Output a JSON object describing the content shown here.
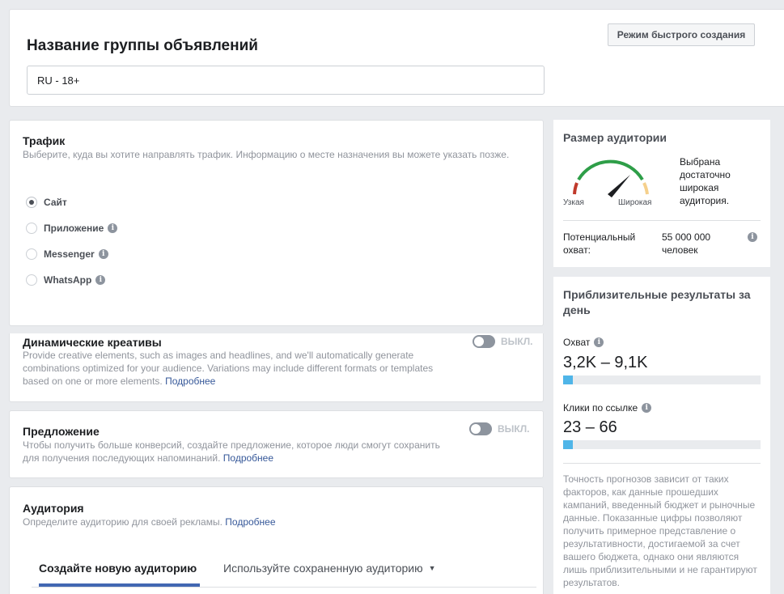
{
  "top": {
    "title": "Название группы объявлений",
    "quick_mode_button": "Режим быстрого создания",
    "ad_set_name": "RU - 18+"
  },
  "traffic": {
    "title": "Трафик",
    "description": "Выберите, куда вы хотите направлять трафик. Информацию о месте назначения вы можете указать позже.",
    "options": [
      {
        "label": "Сайт",
        "checked": true,
        "info": false
      },
      {
        "label": "Приложение",
        "checked": false,
        "info": true
      },
      {
        "label": "Messenger",
        "checked": false,
        "info": true
      },
      {
        "label": "WhatsApp",
        "checked": false,
        "info": true
      }
    ]
  },
  "dynamic": {
    "title": "Динамические креативы",
    "description": "Provide creative elements, such as images and headlines, and we'll automatically generate combinations optimized for your audience. Variations may include different formats or templates based on one or more elements.",
    "link": "Подробнее",
    "toggle_label": "ВЫКЛ."
  },
  "offer": {
    "title": "Предложение",
    "description": "Чтобы получить больше конверсий, создайте предложение, которое люди смогут сохранить для получения последующих напоминаний.",
    "link": "Подробнее",
    "toggle_label": "ВЫКЛ."
  },
  "audience": {
    "title": "Аудитория",
    "description": "Определите аудиторию для своей рекламы.",
    "link": "Подробнее",
    "tab_new": "Создайте новую аудиторию",
    "tab_saved": "Используйте сохраненную аудиторию"
  },
  "audience_size": {
    "title": "Размер аудитории",
    "narrow_label": "Узкая",
    "wide_label": "Широкая",
    "status_text": "Выбрана достаточно широкая аудитория.",
    "potential_reach_label": "Потенциальный охват:",
    "potential_reach_value": "55 000 000 человек"
  },
  "results": {
    "title": "Приблизительные результаты за день",
    "reach_label": "Охват",
    "reach_value": "3,2K – 9,1K",
    "reach_fill": 0.05,
    "clicks_label": "Клики по ссылке",
    "clicks_value": "23 – 66",
    "clicks_fill": 0.05,
    "disclaimer": "Точность прогнозов зависит от таких факторов, как данные прошедших кампаний, введенный бюджет и рыночные данные. Показанные цифры позволяют получить примерное представление о результативности, достигаемой за счет вашего бюджета, однако они являются лишь приблизительными и не гарантируют результатов."
  },
  "colors": {
    "accent": "#4267b2",
    "link": "#365899",
    "progress": "#4fb5e8"
  }
}
